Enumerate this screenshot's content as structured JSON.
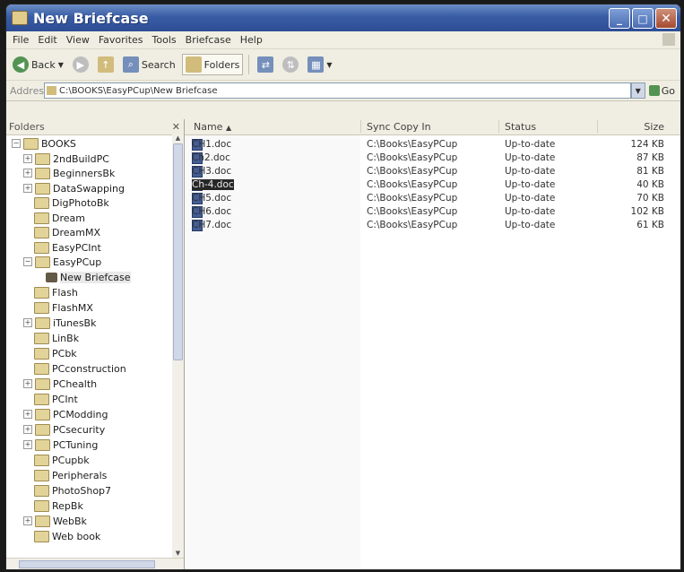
{
  "window": {
    "title": "New Briefcase"
  },
  "menu": [
    "File",
    "Edit",
    "View",
    "Favorites",
    "Tools",
    "Briefcase",
    "Help"
  ],
  "toolbar": {
    "back": "Back",
    "search": "Search",
    "folders": "Folders"
  },
  "address": {
    "label": "Address",
    "path": "C:\\BOOKS\\EasyPCup\\New Briefcase",
    "go": "Go"
  },
  "folders_pane": {
    "header": "Folders",
    "items": [
      "BOOKS",
      "2ndBuildPC",
      "BeginnersBk",
      "DataSwapping",
      "DigPhotoBk",
      "Dream",
      "DreamMX",
      "EasyPCInt",
      "EasyPCup",
      "New Briefcase",
      "Flash",
      "FlashMX",
      "iTunesBk",
      "LinBk",
      "PCbk",
      "PCconstruction",
      "PChealth",
      "PCInt",
      "PCModding",
      "PCsecurity",
      "PCTuning",
      "PCupbk",
      "Peripherals",
      "PhotoShop7",
      "RepBk",
      "WebBk",
      "Web book"
    ]
  },
  "list": {
    "columns": {
      "name": "Name",
      "sync": "Sync Copy In",
      "status": "Status",
      "size": "Size"
    },
    "rows": [
      {
        "name": "CH1.doc",
        "sync": "C:\\Books\\EasyPCup",
        "status": "Up-to-date",
        "size": "124 KB"
      },
      {
        "name": "Ch2.doc",
        "sync": "C:\\Books\\EasyPCup",
        "status": "Up-to-date",
        "size": "87 KB"
      },
      {
        "name": "CH3.doc",
        "sync": "C:\\Books\\EasyPCup",
        "status": "Up-to-date",
        "size": "81 KB"
      },
      {
        "name": "Ch-4.doc",
        "sync": "C:\\Books\\EasyPCup",
        "status": "Up-to-date",
        "size": "40 KB"
      },
      {
        "name": "CH5.doc",
        "sync": "C:\\Books\\EasyPCup",
        "status": "Up-to-date",
        "size": "70 KB"
      },
      {
        "name": "CH6.doc",
        "sync": "C:\\Books\\EasyPCup",
        "status": "Up-to-date",
        "size": "102 KB"
      },
      {
        "name": "CH7.doc",
        "sync": "C:\\Books\\EasyPCup",
        "status": "Up-to-date",
        "size": "61 KB"
      }
    ]
  },
  "colors": {
    "titlebar": "#2b5fc9",
    "chrome": "#ece9d8",
    "selection": "#2a2a2a"
  }
}
